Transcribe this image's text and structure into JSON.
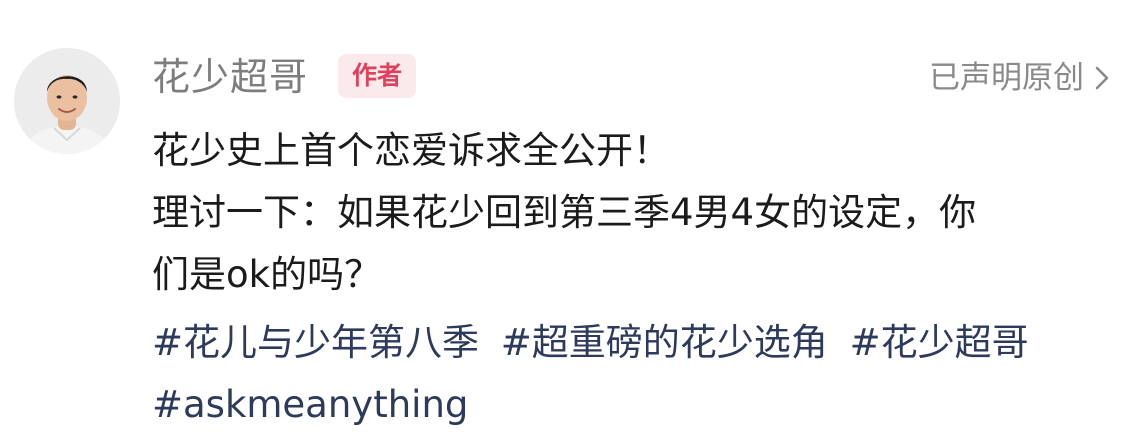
{
  "author": {
    "name": "花少超哥",
    "badge": "作者"
  },
  "declaration": {
    "label": "已声明原创",
    "icon": "chevron-right-icon"
  },
  "post": {
    "lines": [
      "花少史上首个恋爱诉求全公开！",
      "理讨一下：如果花少回到第三季4男4女的设定，你",
      "们是ok的吗？"
    ]
  },
  "topics": [
    "#花儿与少年第八季",
    "#超重磅的花少选角",
    "#花少超哥",
    "#askmeanything"
  ],
  "colors": {
    "badge_bg": "#fbeaec",
    "badge_text": "#e0405b",
    "topic": "#2d3a5c",
    "meta": "#8a8a8a"
  }
}
